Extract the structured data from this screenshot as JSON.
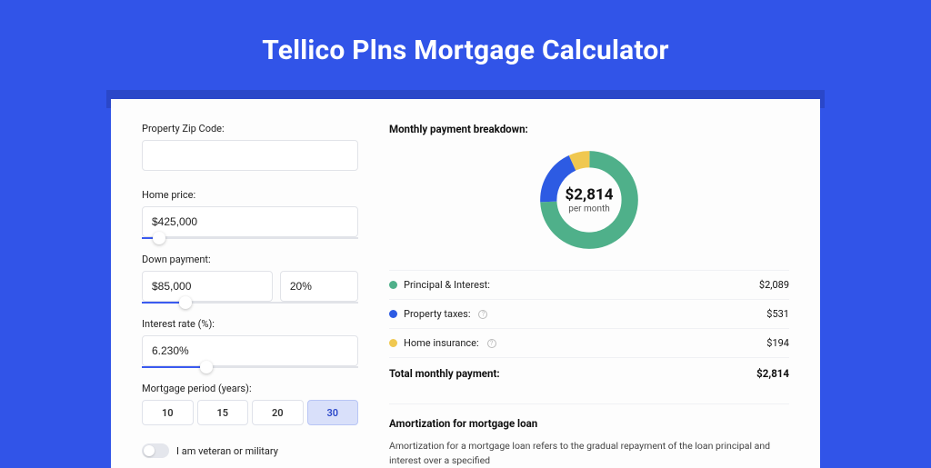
{
  "title": "Tellico Plns Mortgage Calculator",
  "form": {
    "zip_label": "Property Zip Code:",
    "zip_value": "",
    "home_price_label": "Home price:",
    "home_price_value": "$425,000",
    "home_price_slider_pct": 8,
    "down_payment_label": "Down payment:",
    "down_payment_value": "$85,000",
    "down_payment_pct": "20%",
    "down_payment_slider_pct": 20,
    "interest_label": "Interest rate (%):",
    "interest_value": "6.230%",
    "interest_slider_pct": 30,
    "period_label": "Mortgage period (years):",
    "periods": [
      "10",
      "15",
      "20",
      "30"
    ],
    "period_selected": "30",
    "veteran_label": "I am veteran or military"
  },
  "breakdown": {
    "heading": "Monthly payment breakdown:",
    "center_amount": "$2,814",
    "center_sub": "per month",
    "items": [
      {
        "label": "Principal & Interest:",
        "value": "$2,089",
        "color": "#4fb08a",
        "info": false
      },
      {
        "label": "Property taxes:",
        "value": "$531",
        "color": "#2d5be3",
        "info": true
      },
      {
        "label": "Home insurance:",
        "value": "$194",
        "color": "#f0c850",
        "info": true
      }
    ],
    "total_label": "Total monthly payment:",
    "total_value": "$2,814"
  },
  "amort": {
    "heading": "Amortization for mortgage loan",
    "text": "Amortization for a mortgage loan refers to the gradual repayment of the loan principal and interest over a specified"
  },
  "chart_data": {
    "type": "pie",
    "title": "Monthly payment breakdown",
    "series": [
      {
        "name": "Principal & Interest",
        "value": 2089,
        "color": "#4fb08a"
      },
      {
        "name": "Property taxes",
        "value": 531,
        "color": "#2d5be3"
      },
      {
        "name": "Home insurance",
        "value": 194,
        "color": "#f0c850"
      }
    ],
    "total": 2814
  }
}
